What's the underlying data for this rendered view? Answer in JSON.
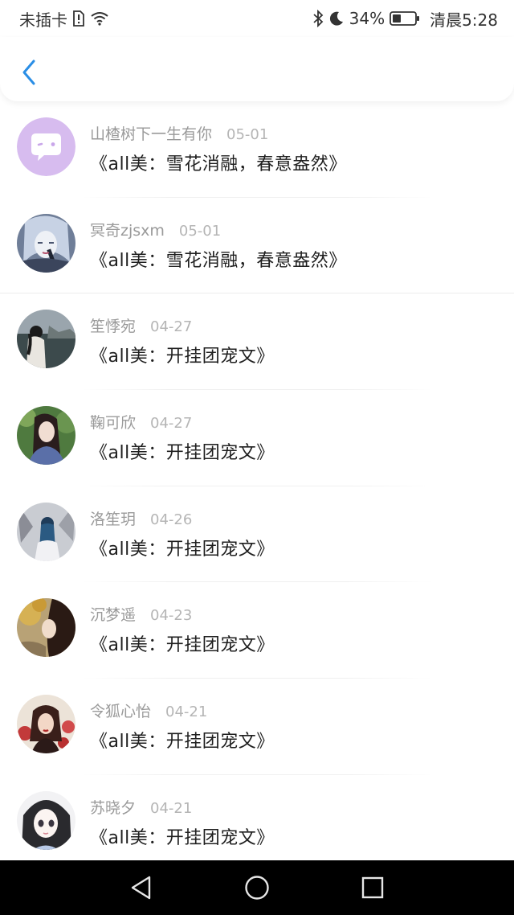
{
  "status_bar": {
    "carrier": "未插卡",
    "battery_percent": "34%",
    "time": "清晨5:28",
    "icons": [
      "sim-alert-icon",
      "wifi-icon",
      "bluetooth-icon",
      "moon-icon",
      "battery-icon"
    ]
  },
  "header": {
    "back_icon": "chevron-left-icon",
    "accent_color": "#2a8ee6"
  },
  "items": [
    {
      "name": "山楂树下一生有你",
      "date": "05-01",
      "title": "《all美：雪花消融，春意盎然》",
      "avatar": "chat-bubble-avatar"
    },
    {
      "name": "冥奇zjsxm",
      "date": "05-01",
      "title": "《all美：雪花消融，春意盎然》",
      "avatar": "anime-avatar"
    },
    {
      "name": "笙悸宛",
      "date": "04-27",
      "title": "《all美：开挂团宠文》",
      "avatar": "photo-avatar"
    },
    {
      "name": "鞠可欣",
      "date": "04-27",
      "title": "《all美：开挂团宠文》",
      "avatar": "photo-avatar"
    },
    {
      "name": "洛笙玥",
      "date": "04-26",
      "title": "《all美：开挂团宠文》",
      "avatar": "photo-avatar"
    },
    {
      "name": "沉梦遥",
      "date": "04-23",
      "title": "《all美：开挂团宠文》",
      "avatar": "photo-avatar"
    },
    {
      "name": "令狐心怡",
      "date": "04-21",
      "title": "《all美：开挂团宠文》",
      "avatar": "photo-avatar"
    },
    {
      "name": "苏晓夕",
      "date": "04-21",
      "title": "《all美：开挂团宠文》",
      "avatar": "anime-avatar"
    }
  ],
  "nav_bar": {
    "buttons": [
      "back-triangle-icon",
      "home-circle-icon",
      "recents-square-icon"
    ]
  }
}
